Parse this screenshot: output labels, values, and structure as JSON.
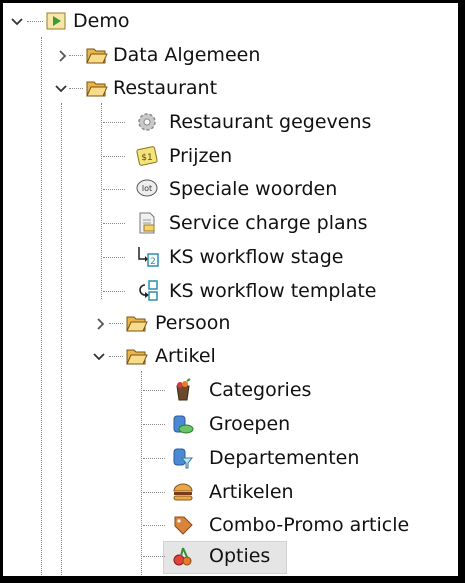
{
  "tree": {
    "root": {
      "label": "Demo"
    },
    "data_algemeen": {
      "label": "Data Algemeen"
    },
    "restaurant": {
      "label": "Restaurant",
      "children": {
        "gegevens": "Restaurant gegevens",
        "prijzen": "Prijzen",
        "speciale": "Speciale woorden",
        "service": "Service charge plans",
        "ks_stage": "KS workflow stage",
        "ks_template": "KS workflow template"
      }
    },
    "persoon": {
      "label": "Persoon"
    },
    "artikel": {
      "label": "Artikel",
      "children": {
        "categories": "Categories",
        "groepen": "Groepen",
        "departementen": "Departementen",
        "artikelen": "Artikelen",
        "combo": "Combo-Promo article",
        "opties": "Opties"
      }
    },
    "selected": "Opties"
  },
  "icon_text": {
    "prijzen": "$1",
    "speciale": "lot",
    "ks_stage": "2"
  }
}
